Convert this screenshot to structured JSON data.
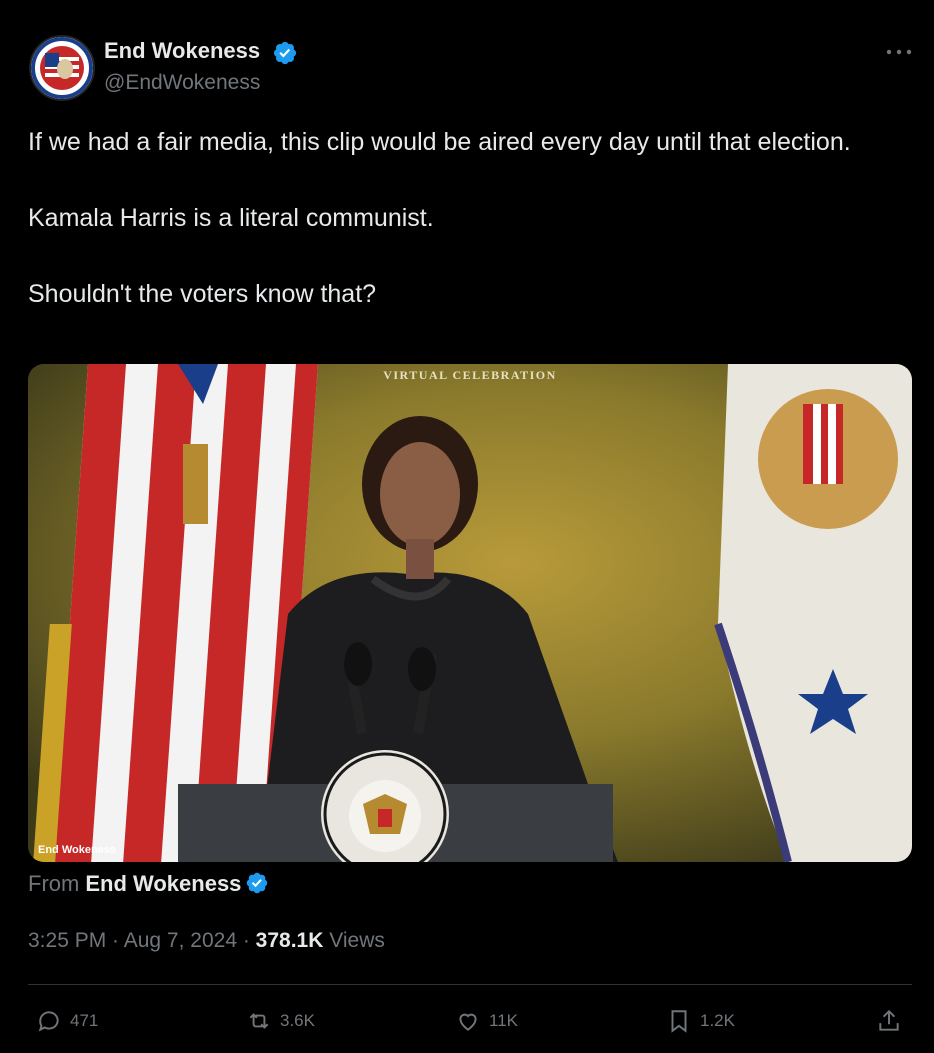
{
  "author": {
    "display_name": "End Wokeness",
    "handle": "@EndWokeness",
    "avatar_text": "CONSERVATIVE"
  },
  "tweet": {
    "paragraphs": [
      "If we had a fair media, this clip would be aired every day until that election.",
      "Kamala Harris is a literal communist.",
      "Shouldn't the voters know that?"
    ]
  },
  "media": {
    "banner_text": "VIRTUAL CELEBRATION",
    "watermark": "End Wokeness",
    "seal_text": "PRESIDENT OF THE UNITED ST"
  },
  "attribution": {
    "from_label": "From",
    "from_name": "End Wokeness"
  },
  "meta": {
    "time": "3:25 PM",
    "sep1": " · ",
    "date": "Aug 7, 2024",
    "sep2": " · ",
    "views_count": "378.1K",
    "views_label": " Views"
  },
  "actions": {
    "replies": "471",
    "reposts": "3.6K",
    "likes": "11K",
    "bookmarks": "1.2K"
  },
  "colors": {
    "background": "#000000",
    "text": "#e7e9ea",
    "muted": "#71767b",
    "verified": "#1d9bf0"
  }
}
